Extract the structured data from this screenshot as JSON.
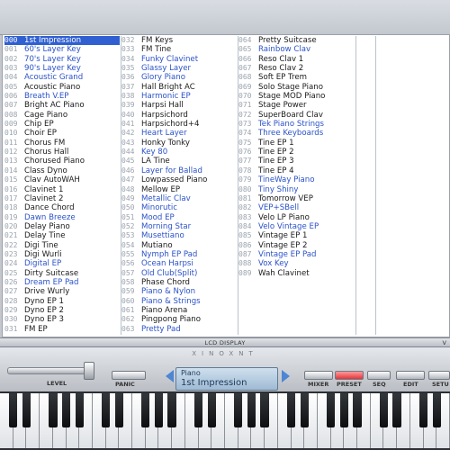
{
  "status_bar": {
    "label": "LCD DISPLAY",
    "right_text": "V"
  },
  "brand": "XINOXNT",
  "controls": {
    "level_label": "LEVEL",
    "panic_label": "PANIC",
    "mixer_label": "MIXER",
    "preset_label": "PRESET",
    "seq_label": "SEQ",
    "edit_label": "EDIT",
    "setup_label": "SETU"
  },
  "lcd": {
    "category": "Piano",
    "patch": "1st Impression"
  },
  "colors": {
    "selection": "#2f5fd0",
    "highlight_text": "#2a52c9",
    "preset_button": "#e2353b",
    "lcd": "#b5cbe0"
  },
  "patches": {
    "col1": [
      {
        "num": "000",
        "name": "1st Impression",
        "style": "sel"
      },
      {
        "num": "001",
        "name": "60's Layer Key",
        "style": "blue"
      },
      {
        "num": "002",
        "name": "70's Layer Key",
        "style": "blue"
      },
      {
        "num": "003",
        "name": "90's Layer Key",
        "style": "blue"
      },
      {
        "num": "004",
        "name": "Acoustic Grand",
        "style": "blue"
      },
      {
        "num": "005",
        "name": "Acoustic Piano",
        "style": ""
      },
      {
        "num": "006",
        "name": "Breath V.EP",
        "style": "blue"
      },
      {
        "num": "007",
        "name": "Bright AC Piano",
        "style": ""
      },
      {
        "num": "008",
        "name": "Cage Piano",
        "style": ""
      },
      {
        "num": "009",
        "name": "Chip EP",
        "style": ""
      },
      {
        "num": "010",
        "name": "Choir EP",
        "style": ""
      },
      {
        "num": "011",
        "name": "Chorus FM",
        "style": ""
      },
      {
        "num": "012",
        "name": "Chorus Hall",
        "style": ""
      },
      {
        "num": "013",
        "name": "Chorused Piano",
        "style": ""
      },
      {
        "num": "014",
        "name": "Class Dyno",
        "style": ""
      },
      {
        "num": "015",
        "name": "Clav AutoWAH",
        "style": ""
      },
      {
        "num": "016",
        "name": "Clavinet 1",
        "style": ""
      },
      {
        "num": "017",
        "name": "Clavinet 2",
        "style": ""
      },
      {
        "num": "018",
        "name": "Dance Chord",
        "style": ""
      },
      {
        "num": "019",
        "name": "Dawn Breeze",
        "style": "blue"
      },
      {
        "num": "020",
        "name": "Delay Piano",
        "style": ""
      },
      {
        "num": "021",
        "name": "Delay Tine",
        "style": ""
      },
      {
        "num": "022",
        "name": "Digi Tine",
        "style": ""
      },
      {
        "num": "023",
        "name": "Digi Wurli",
        "style": ""
      },
      {
        "num": "024",
        "name": "Digital EP",
        "style": "blue"
      },
      {
        "num": "025",
        "name": "Dirty Suitcase",
        "style": ""
      },
      {
        "num": "026",
        "name": "Dream EP Pad",
        "style": "blue"
      },
      {
        "num": "027",
        "name": "Drive Wurly",
        "style": ""
      },
      {
        "num": "028",
        "name": "Dyno EP 1",
        "style": ""
      },
      {
        "num": "029",
        "name": "Dyno EP 2",
        "style": ""
      },
      {
        "num": "030",
        "name": "Dyno EP 3",
        "style": ""
      },
      {
        "num": "031",
        "name": "FM EP",
        "style": ""
      }
    ],
    "col2": [
      {
        "num": "032",
        "name": "FM Keys",
        "style": ""
      },
      {
        "num": "033",
        "name": "FM Tine",
        "style": ""
      },
      {
        "num": "034",
        "name": "Funky Clavinet",
        "style": "blue"
      },
      {
        "num": "035",
        "name": "Glassy Layer",
        "style": "blue"
      },
      {
        "num": "036",
        "name": "Glory Piano",
        "style": "blue"
      },
      {
        "num": "037",
        "name": "Hall Bright AC",
        "style": ""
      },
      {
        "num": "038",
        "name": "Harmonic EP",
        "style": "blue"
      },
      {
        "num": "039",
        "name": "Harpsi Hall",
        "style": ""
      },
      {
        "num": "040",
        "name": "Harpsichord",
        "style": ""
      },
      {
        "num": "041",
        "name": "Harpsichord+4",
        "style": ""
      },
      {
        "num": "042",
        "name": "Heart Layer",
        "style": "blue"
      },
      {
        "num": "043",
        "name": "Honky Tonky",
        "style": ""
      },
      {
        "num": "044",
        "name": "Key 80",
        "style": "blue"
      },
      {
        "num": "045",
        "name": "LA Tine",
        "style": ""
      },
      {
        "num": "046",
        "name": "Layer for Ballad",
        "style": "blue"
      },
      {
        "num": "047",
        "name": "Lowpassed Piano",
        "style": ""
      },
      {
        "num": "048",
        "name": "Mellow EP",
        "style": ""
      },
      {
        "num": "049",
        "name": "Metallic Clav",
        "style": "blue"
      },
      {
        "num": "050",
        "name": "Minorutic",
        "style": "blue"
      },
      {
        "num": "051",
        "name": "Mood EP",
        "style": "blue"
      },
      {
        "num": "052",
        "name": "Morning Star",
        "style": "blue"
      },
      {
        "num": "053",
        "name": "Musettiano",
        "style": "blue"
      },
      {
        "num": "054",
        "name": "Mutiano",
        "style": ""
      },
      {
        "num": "055",
        "name": "Nymph EP Pad",
        "style": "blue"
      },
      {
        "num": "056",
        "name": "Ocean Harpsi",
        "style": "blue"
      },
      {
        "num": "057",
        "name": "Old Club(Split)",
        "style": "blue"
      },
      {
        "num": "058",
        "name": "Phase Chord",
        "style": ""
      },
      {
        "num": "059",
        "name": "Piano & Nylon",
        "style": "blue"
      },
      {
        "num": "060",
        "name": "Piano & Strings",
        "style": "blue"
      },
      {
        "num": "061",
        "name": "Piano Arena",
        "style": ""
      },
      {
        "num": "062",
        "name": "Pingpong Piano",
        "style": ""
      },
      {
        "num": "063",
        "name": "Pretty Pad",
        "style": "blue"
      }
    ],
    "col3": [
      {
        "num": "064",
        "name": "Pretty Suitcase",
        "style": ""
      },
      {
        "num": "065",
        "name": "Rainbow Clav",
        "style": "blue"
      },
      {
        "num": "066",
        "name": "Reso Clav 1",
        "style": ""
      },
      {
        "num": "067",
        "name": "Reso Clav 2",
        "style": ""
      },
      {
        "num": "068",
        "name": "Soft EP Trem",
        "style": ""
      },
      {
        "num": "069",
        "name": "Solo Stage Piano",
        "style": ""
      },
      {
        "num": "070",
        "name": "Stage MOD Piano",
        "style": ""
      },
      {
        "num": "071",
        "name": "Stage Power",
        "style": ""
      },
      {
        "num": "072",
        "name": "SuperBoard Clav",
        "style": ""
      },
      {
        "num": "073",
        "name": "Tek Piano Strings",
        "style": "blue"
      },
      {
        "num": "074",
        "name": "Three Keyboards",
        "style": "blue"
      },
      {
        "num": "075",
        "name": "Tine EP 1",
        "style": ""
      },
      {
        "num": "076",
        "name": "Tine EP 2",
        "style": ""
      },
      {
        "num": "077",
        "name": "Tine EP 3",
        "style": ""
      },
      {
        "num": "078",
        "name": "Tine EP 4",
        "style": ""
      },
      {
        "num": "079",
        "name": "TineWay Piano",
        "style": "blue"
      },
      {
        "num": "080",
        "name": "Tiny Shiny",
        "style": "blue"
      },
      {
        "num": "081",
        "name": "Tomorrow VEP",
        "style": ""
      },
      {
        "num": "082",
        "name": "VEP+SBell",
        "style": "blue"
      },
      {
        "num": "083",
        "name": "Velo LP Piano",
        "style": ""
      },
      {
        "num": "084",
        "name": "Velo Vintage EP",
        "style": "blue"
      },
      {
        "num": "085",
        "name": "Vintage EP 1",
        "style": ""
      },
      {
        "num": "086",
        "name": "Vintage EP 2",
        "style": ""
      },
      {
        "num": "087",
        "name": "Vintage EP Pad",
        "style": "blue"
      },
      {
        "num": "088",
        "name": "Vox Key",
        "style": "blue"
      },
      {
        "num": "089",
        "name": "Wah Clavinet",
        "style": ""
      }
    ]
  }
}
